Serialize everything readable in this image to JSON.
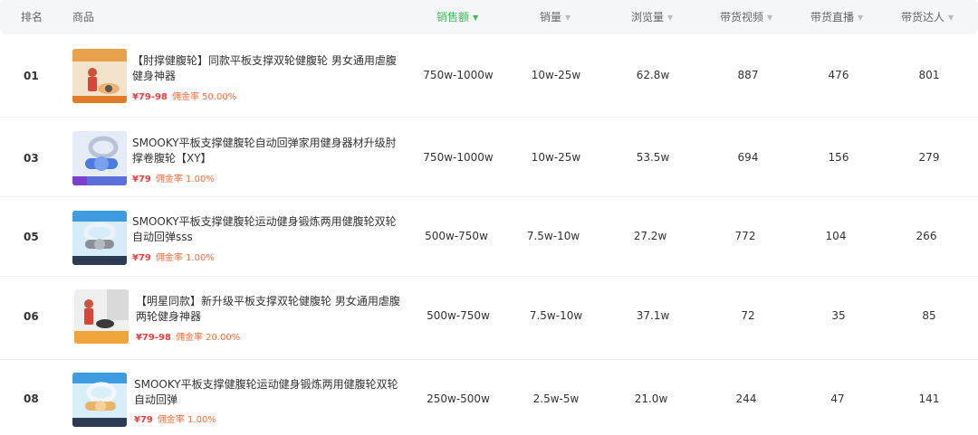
{
  "header": {
    "rank": "排名",
    "product": "商品",
    "sales_amount": "销售额",
    "sales_volume": "销量",
    "views": "浏览量",
    "videos": "带货视频",
    "lives": "带货直播",
    "influencers": "带货达人"
  },
  "rows": [
    {
      "rank": "01",
      "title": "【肘撑健腹轮】同款平板支撑双轮健腹轮 男女通用虐腹健身神器",
      "price": "¥79-98",
      "commission": "佣金率 50.00%",
      "sales_amount": "750w-1000w",
      "sales_volume": "10w-25w",
      "views": "62.8w",
      "videos": "887",
      "lives": "476",
      "influencers": "801"
    },
    {
      "rank": "03",
      "title": "SMOOKY平板支撑健腹轮自动回弹家用健身器材升级肘撑卷腹轮【XY】",
      "price": "¥79",
      "commission": "佣金率 1.00%",
      "sales_amount": "750w-1000w",
      "sales_volume": "10w-25w",
      "views": "53.5w",
      "videos": "694",
      "lives": "156",
      "influencers": "279"
    },
    {
      "rank": "05",
      "title": "SMOOKY平板支撑健腹轮运动健身锻炼两用健腹轮双轮自动回弹sss",
      "price": "¥79",
      "commission": "佣金率 1.00%",
      "sales_amount": "500w-750w",
      "sales_volume": "7.5w-10w",
      "views": "27.2w",
      "videos": "772",
      "lives": "104",
      "influencers": "266"
    },
    {
      "rank": "06",
      "title": "【明星同款】新升级平板支撑双轮健腹轮 男女通用虐腹两轮健身神器",
      "price": "¥79-98",
      "commission": "佣金率 20.00%",
      "sales_amount": "500w-750w",
      "sales_volume": "7.5w-10w",
      "views": "37.1w",
      "videos": "72",
      "lives": "35",
      "influencers": "85"
    },
    {
      "rank": "08",
      "title": "SMOOKY平板支撑健腹轮运动健身锻炼两用健腹轮双轮自动回弹",
      "price": "¥79",
      "commission": "佣金率 1.00%",
      "sales_amount": "250w-500w",
      "sales_volume": "2.5w-5w",
      "views": "21.0w",
      "videos": "244",
      "lives": "47",
      "influencers": "141"
    }
  ],
  "colors": {
    "accent": "#42b85b",
    "price": "#ee3d3d",
    "commission": "#ff6a39"
  }
}
